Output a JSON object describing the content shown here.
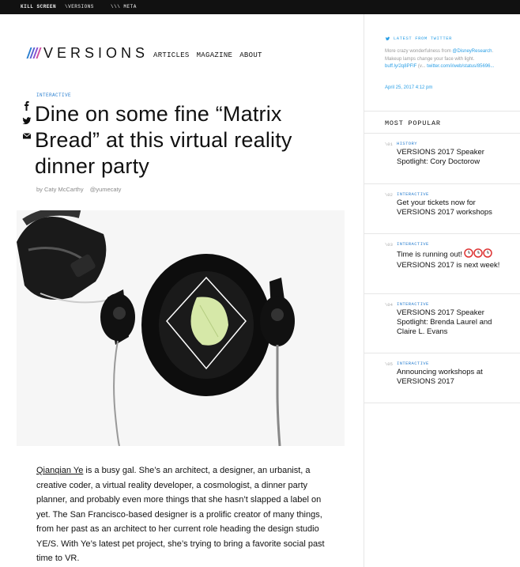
{
  "topbar": {
    "items": [
      "KILL SCREEN",
      "\\VERSIONS",
      "\\\\\\ META"
    ]
  },
  "brand": {
    "logo_text": "VERSIONS",
    "mark_colors": [
      "#2a7fd0",
      "#7a4fd0",
      "#d04fa0"
    ]
  },
  "nav": {
    "items": [
      "ARTICLES",
      "MAGAZINE",
      "ABOUT"
    ]
  },
  "article": {
    "category": "INTERACTIVE",
    "title": "Dine on some fine “Matrix Bread” at this virtual reality dinner party",
    "byline_author": "by Caty McCarthy",
    "byline_handle": "@yumecaty",
    "body_link": "Qianqian Ye",
    "body_rest": " is a busy gal. She’s an architect, a designer, an urbanist, a creative coder, a virtual reality developer, a cosmologist, a dinner party planner, and probably even more things that she hasn’t slapped a label on yet. The San Francisco-based designer is a prolific creator of many things, from her past as an architect to her current role heading the design studio YE/S. With Ye’s latest pet project, she’s trying to bring a favorite social past time to VR.",
    "share_icons": [
      "facebook-icon",
      "twitter-icon",
      "email-icon"
    ]
  },
  "sidebar": {
    "twitter": {
      "heading": "LATEST FROM TWITTER",
      "text_before": "More crazy wonderfulness from ",
      "mention": "@DisneyResearch",
      "text_mid": ". Makeup lamps change your face with light. ",
      "link1": "buff.ly/2q8PFlF",
      "text_after": " (v... ",
      "link2": "twitter.com/i/web/status/85696...",
      "date": "April 25, 2017 4:12 pm"
    },
    "most_popular": {
      "heading": "MOST POPULAR",
      "items": [
        {
          "num": "\\01",
          "category": "HISTORY",
          "title": "VERSIONS 2017 Speaker Spotlight: Cory Doctorow"
        },
        {
          "num": "\\02",
          "category": "INTERACTIVE",
          "title": "Get your tickets now for VERSIONS 2017 workshops"
        },
        {
          "num": "\\03",
          "category": "INTERACTIVE",
          "title_a": "Time is running out!",
          "title_b": "VERSIONS 2017 is next week!"
        },
        {
          "num": "\\04",
          "category": "INTERACTIVE",
          "title": "VERSIONS 2017 Speaker Spotlight: Brenda Laurel and Claire L. Evans"
        },
        {
          "num": "\\05",
          "category": "INTERACTIVE",
          "title": "Announcing workshops at VERSIONS 2017"
        }
      ]
    }
  },
  "colors": {
    "accent_blue": "#2a7fd0",
    "twitter_blue": "#2a9fe6"
  }
}
